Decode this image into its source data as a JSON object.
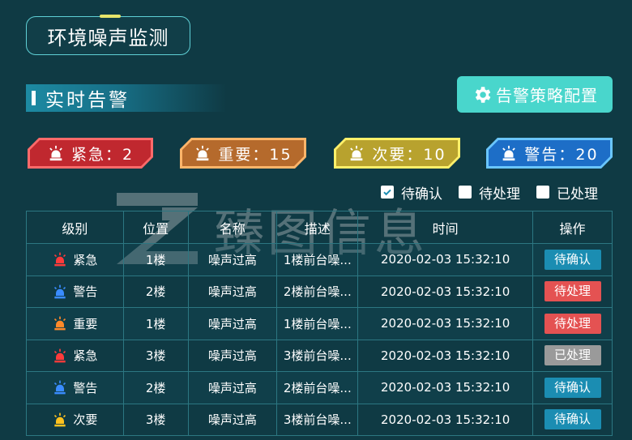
{
  "title": "环境噪声监测",
  "section_title": "实时告警",
  "strategy_button": "告警策略配置",
  "badges": {
    "urgent": "紧急：2",
    "important": "重要：15",
    "minor": "次要：10",
    "warning": "警告：20"
  },
  "filters": [
    {
      "label": "待确认",
      "checked": true
    },
    {
      "label": "待处理",
      "checked": false
    },
    {
      "label": "已处理",
      "checked": false
    }
  ],
  "table": {
    "headers": [
      "级别",
      "位置",
      "名称",
      "描述",
      "时间",
      "操作"
    ],
    "rows": [
      {
        "level": "紧急",
        "level_color": "#ff3b3b",
        "position": "1楼",
        "name": "噪声过高",
        "desc": "1楼前台噪...",
        "time": "2020-02-03 15:32:10",
        "op": "待确认",
        "op_class": "op-pending-confirm"
      },
      {
        "level": "警告",
        "level_color": "#3a8cff",
        "position": "2楼",
        "name": "噪声过高",
        "desc": "2楼前台噪...",
        "time": "2020-02-03 15:32:10",
        "op": "待处理",
        "op_class": "op-pending-handle"
      },
      {
        "level": "重要",
        "level_color": "#ff8a2a",
        "position": "1楼",
        "name": "噪声过高",
        "desc": "1楼前台噪...",
        "time": "2020-02-03 15:32:10",
        "op": "待处理",
        "op_class": "op-pending-handle"
      },
      {
        "level": "紧急",
        "level_color": "#ff3b3b",
        "position": "3楼",
        "name": "噪声过高",
        "desc": "3楼前台噪...",
        "time": "2020-02-03 15:32:10",
        "op": "已处理",
        "op_class": "op-handled"
      },
      {
        "level": "警告",
        "level_color": "#3a8cff",
        "position": "2楼",
        "name": "噪声过高",
        "desc": "2楼前台噪...",
        "time": "2020-02-03 15:32:10",
        "op": "待确认",
        "op_class": "op-pending-confirm"
      },
      {
        "level": "次要",
        "level_color": "#ffc21f",
        "position": "3楼",
        "name": "噪声过高",
        "desc": "3楼前台噪...",
        "time": "2020-02-03 15:32:10",
        "op": "待确认",
        "op_class": "op-pending-confirm"
      }
    ]
  },
  "watermark": "臻图信息",
  "colors": {
    "background": "#0f3a44",
    "accent": "#49d6cc",
    "urgent": "#c0282f",
    "important": "#b56a2c",
    "minor": "#b8a22e",
    "warning": "#1d6ec7"
  }
}
